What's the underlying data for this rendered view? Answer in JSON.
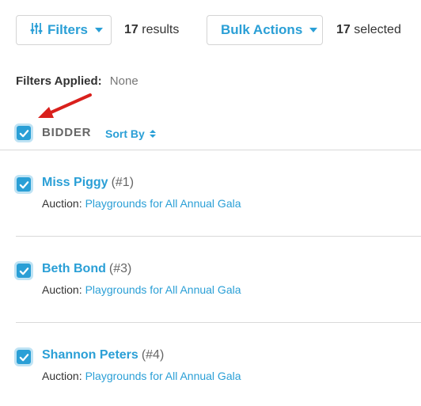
{
  "toolbar": {
    "filters_label": "Filters",
    "results_count": "17",
    "results_label": "results",
    "bulk_label": "Bulk Actions",
    "selected_count": "17",
    "selected_label": "selected"
  },
  "filters_applied": {
    "label": "Filters Applied:",
    "value": "None"
  },
  "table": {
    "column_label": "BIDDER",
    "sort_label": "Sort By"
  },
  "bidders": [
    {
      "name": "Miss Piggy",
      "number": "(#1)",
      "auction_label": "Auction:",
      "auction": "Playgrounds for All Annual Gala"
    },
    {
      "name": "Beth Bond",
      "number": "(#3)",
      "auction_label": "Auction:",
      "auction": "Playgrounds for All Annual Gala"
    },
    {
      "name": "Shannon Peters",
      "number": "(#4)",
      "auction_label": "Auction:",
      "auction": "Playgrounds for All Annual Gala"
    }
  ],
  "colors": {
    "accent": "#2a9fd6",
    "arrow": "#d9201c"
  },
  "icons": [
    "sliders-icon",
    "caret-down-icon",
    "check-icon",
    "sort-icon",
    "annotation-arrow"
  ]
}
